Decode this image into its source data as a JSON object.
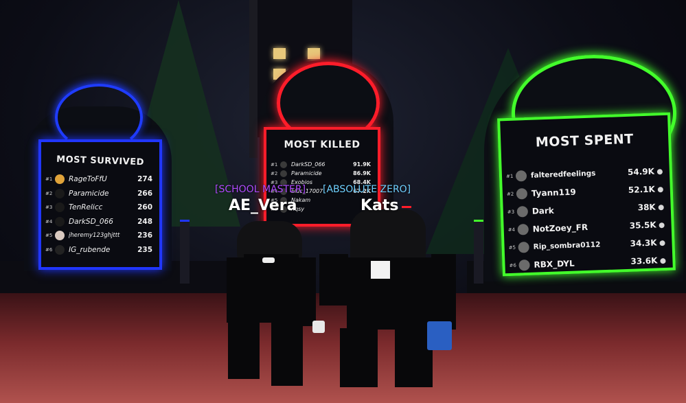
{
  "scene": {
    "colors": {
      "blue": "#2036ff",
      "red": "#ff1d2a",
      "green": "#43ff2b",
      "school_master": "#b14cff",
      "absolute_zero": "#6fd0ff"
    }
  },
  "boards": {
    "most_survived": {
      "title": "MOST SURVIVED",
      "rows": [
        {
          "rank": "#1",
          "name": "RageToFfU",
          "value": "274"
        },
        {
          "rank": "#2",
          "name": "Paramicide",
          "value": "266"
        },
        {
          "rank": "#3",
          "name": "TenRelicc",
          "value": "260"
        },
        {
          "rank": "#4",
          "name": "DarkSD_066",
          "value": "248"
        },
        {
          "rank": "#5",
          "name": "jheremy123ghjttt",
          "value": "236"
        },
        {
          "rank": "#6",
          "name": "IG_rubende",
          "value": "235"
        }
      ]
    },
    "most_killed": {
      "title": "MOST KILLED",
      "rows": [
        {
          "rank": "#1",
          "name": "DarkSD_066",
          "value": "91.9K"
        },
        {
          "rank": "#2",
          "name": "Paramicide",
          "value": "86.9K"
        },
        {
          "rank": "#3",
          "name": "Exobios",
          "value": "68.4K"
        },
        {
          "rank": "#4",
          "name": "bluc_17007",
          "value": "67.2K"
        },
        {
          "rank": "#5",
          "name": "Nakam",
          "value": ""
        },
        {
          "rank": "#6",
          "name": "hqsy",
          "value": ""
        }
      ]
    },
    "most_spent": {
      "title": "MOST SPENT",
      "rows": [
        {
          "rank": "#1",
          "name": "falteredfeelings",
          "value": "54.9K"
        },
        {
          "rank": "#2",
          "name": "Tyann119",
          "value": "52.1K"
        },
        {
          "rank": "#3",
          "name": "Dark",
          "value": "38K"
        },
        {
          "rank": "#4",
          "name": "NotZoey_FR",
          "value": "35.5K"
        },
        {
          "rank": "#5",
          "name": "Rip_sombra0112",
          "value": "34.3K"
        },
        {
          "rank": "#6",
          "name": "RBX_DYL",
          "value": "33.6K"
        }
      ]
    }
  },
  "players": {
    "left": {
      "title": "[SCHOOL MASTER]",
      "name": "AE_Vera"
    },
    "right": {
      "title": "[ABSOLUTE ZERO]",
      "name": "Kats"
    }
  }
}
